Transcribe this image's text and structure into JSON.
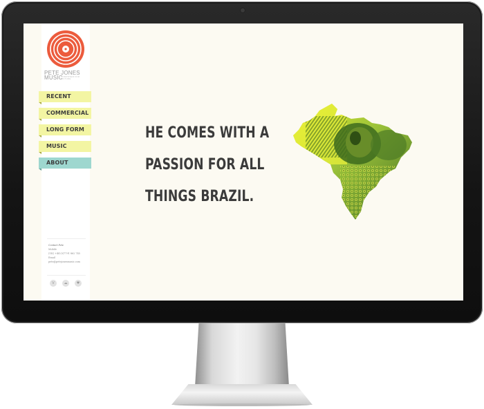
{
  "brand": {
    "line1": "PETE JONES",
    "line2": "MUSIC",
    "tagline": "COMPOSER FOR PICTURE"
  },
  "nav": {
    "items": [
      {
        "label": "RECENT"
      },
      {
        "label": "COMMERCIAL"
      },
      {
        "label": "LONG FORM"
      },
      {
        "label": "MUSIC"
      },
      {
        "label": "ABOUT"
      }
    ],
    "active": "ABOUT"
  },
  "contact": {
    "heading": "Contact Pete",
    "mobile_label": "Mobile",
    "mobile_value": "(UK) +44 (0)7791 862 745",
    "email_label": "Email",
    "email_value": "pete@petejonesmusic.com"
  },
  "socials": [
    {
      "icon": "vimeo-icon",
      "glyph": "V"
    },
    {
      "icon": "soundcloud-icon",
      "glyph": "☁"
    },
    {
      "icon": "twitter-icon",
      "glyph": "♥"
    }
  ],
  "headline": {
    "line1": "HE COMES WITH A",
    "line2": "PASSION FOR ALL",
    "line3": "THINGS BRAZIL."
  },
  "colors": {
    "screen_bg": "#fcfaf2",
    "nav_yellow": "#f3f5a3",
    "nav_active": "#9ed7cf",
    "logo_red": "#ec5b3d",
    "map_green": "#9bc23a",
    "headline": "#3b3b3b"
  }
}
